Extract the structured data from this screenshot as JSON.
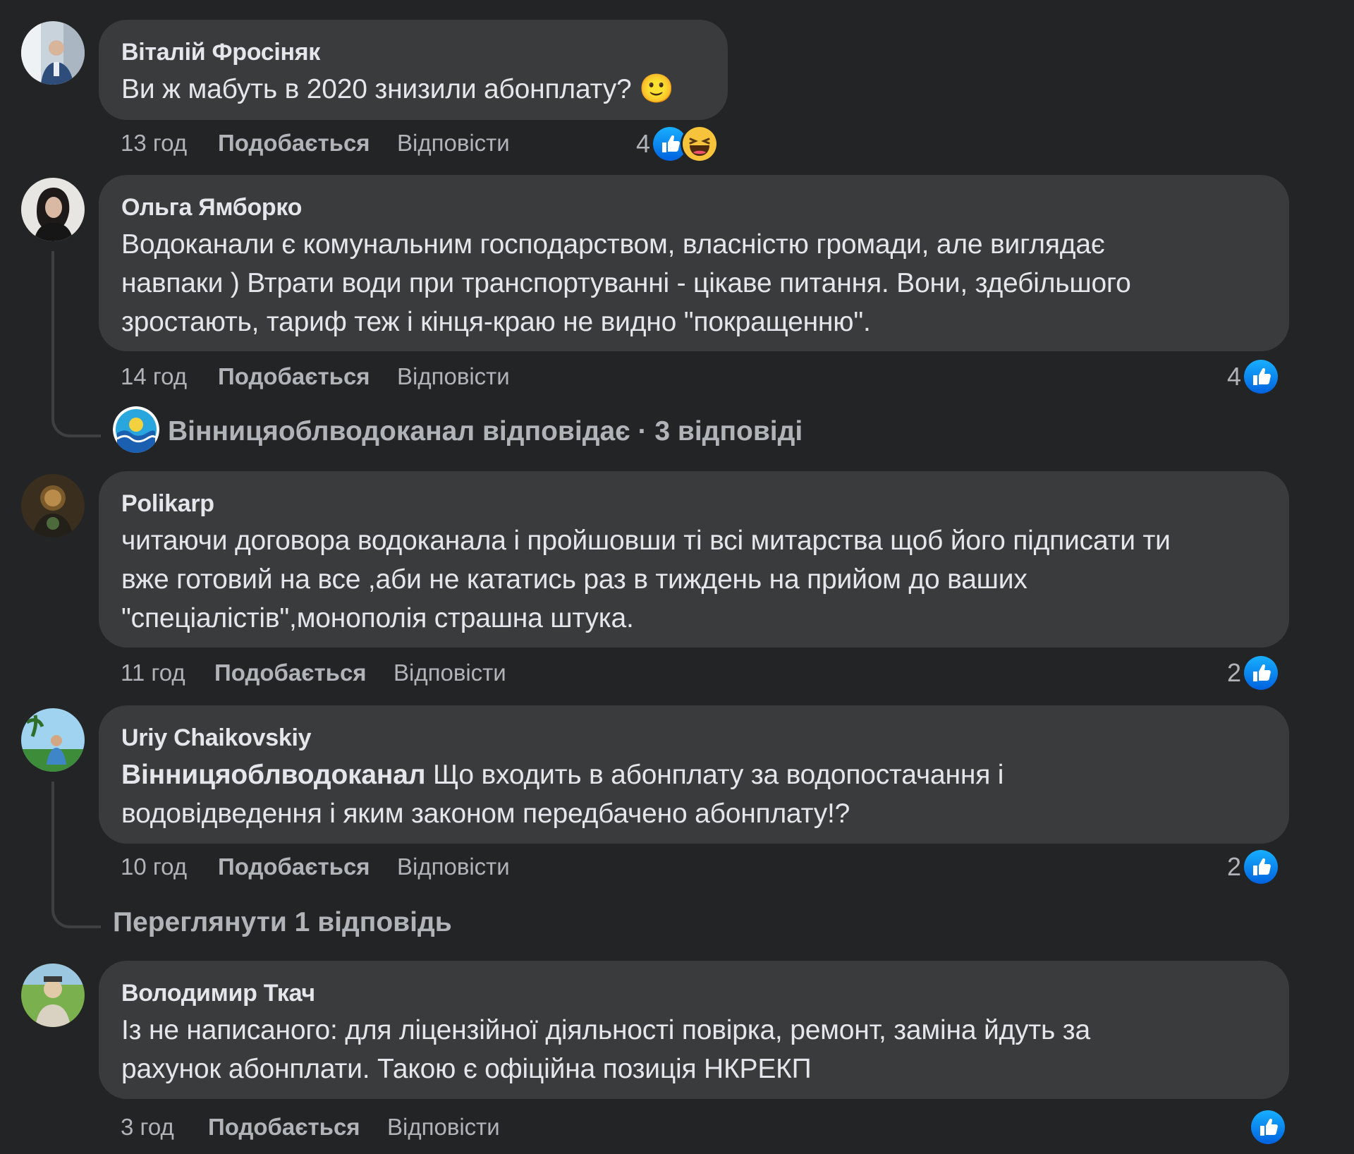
{
  "common": {
    "like_label": "Подобається",
    "reply_label": "Відповісти"
  },
  "comments": [
    {
      "author": "Віталій Фросіняк",
      "text": "Ви ж мабуть в 2020 знизили абонплату?",
      "emoji": "🙂",
      "time": "13 год",
      "reaction_count": "4",
      "reactions": [
        "like-icon",
        "haha-icon"
      ]
    },
    {
      "author": "Ольга Ямборко",
      "text_lines": [
        "Водоканали є комунальним господарством, власністю громади, але виглядає",
        "навпаки ) Втрати води при транспортуванні - цікаве питання. Вони, здебільшого",
        "зростають, тариф теж і кінця-краю не видно \"покращенню\"."
      ],
      "time": "14 год",
      "reaction_count": "4",
      "reactions": [
        "like-icon"
      ],
      "replies_summary": "Вінницяоблводоканал відповідає · 3 відповіді"
    },
    {
      "author": "Polikarp",
      "text_lines": [
        "читаючи договора водоканала і пройшовши ті всі митарства щоб його підписати ти",
        "вже готовий на все ,аби не кататись раз в тиждень на прийом до ваших",
        "\"спеціалістів\",монополія страшна штука."
      ],
      "time": "11 год",
      "reaction_count": "2",
      "reactions": [
        "like-icon"
      ]
    },
    {
      "author": "Uriy Chaikovskiy",
      "mention": "Вінницяоблводоканал",
      "text_line1_rest": " Що входить в абонплату за водопостачання і",
      "text_line2": "водовідведення і яким законом передбачено абонплату!?",
      "time": "10 год",
      "reaction_count": "2",
      "reactions": [
        "like-icon"
      ],
      "replies_summary": "Переглянути 1 відповідь"
    },
    {
      "author": "Володимир Ткач",
      "text_lines": [
        "Із не написаного: для ліцензійної діяльності повірка, ремонт, заміна йдуть за",
        "рахунок абонплати. Такою є офіційна позиція НКРЕКП"
      ],
      "time": "3 год",
      "reaction_count": "",
      "reactions": [
        "like-icon"
      ]
    }
  ],
  "colors": {
    "background": "#232426",
    "bubble": "#3a3b3c",
    "text": "#e4e6eb",
    "secondary": "#b0b3b8",
    "like_blue": "#1877f2"
  }
}
